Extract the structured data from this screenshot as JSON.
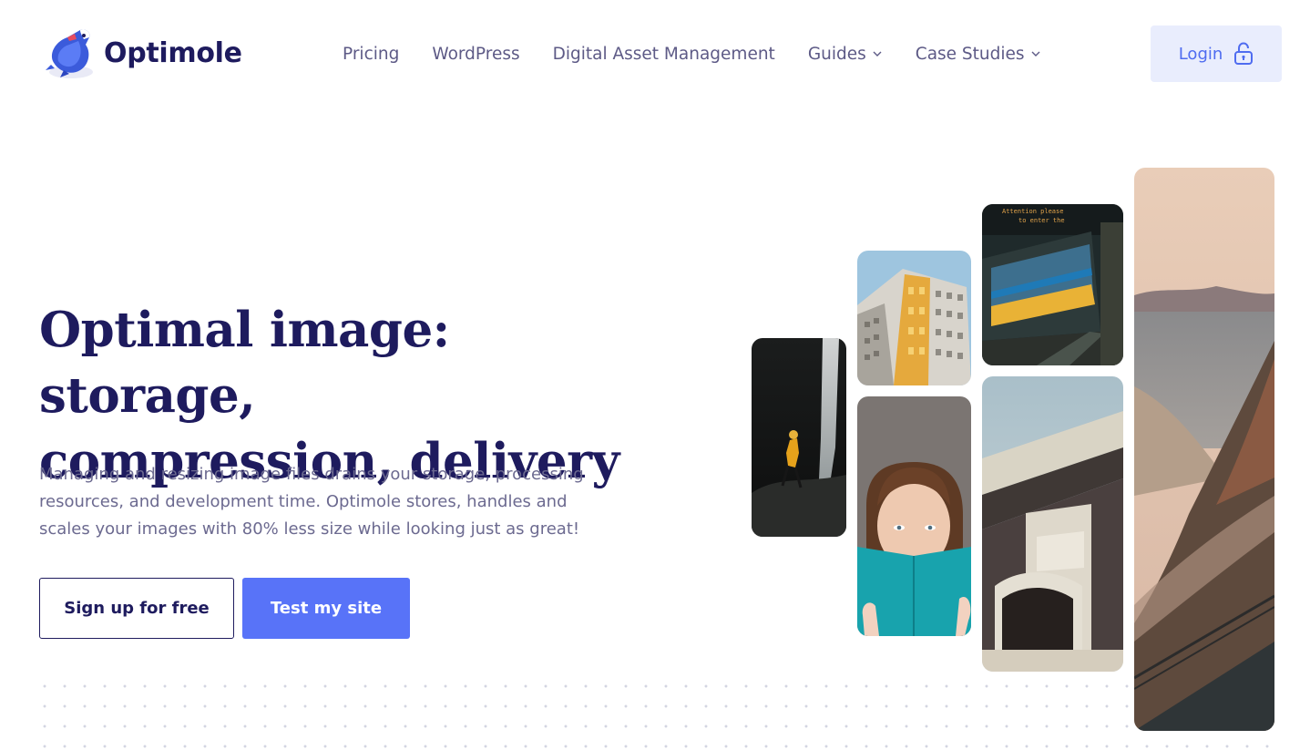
{
  "brand": {
    "name": "Optimole",
    "logo_icon": "optimole-mole-mascot-icon"
  },
  "nav": {
    "items": [
      {
        "label": "Pricing",
        "has_dropdown": false
      },
      {
        "label": "WordPress",
        "has_dropdown": false
      },
      {
        "label": "Digital Asset Management",
        "has_dropdown": false
      },
      {
        "label": "Guides",
        "has_dropdown": true
      },
      {
        "label": "Case Studies",
        "has_dropdown": true
      }
    ],
    "dropdown_icon": "chevron-down-icon"
  },
  "login": {
    "label": "Login",
    "icon": "unlock-icon"
  },
  "hero": {
    "title_line1": "Optimal image: storage,",
    "title_line2": "compression, delivery",
    "description": "Managing and resizing image files drains your storage, processing resources, and development time. Optimole stores, handles and scales your images with 80% less size while looking just as great!",
    "primary_cta": "Test my site",
    "secondary_cta": "Sign up for free"
  },
  "gallery": {
    "images": [
      {
        "name": "hiker-at-waterfall"
      },
      {
        "name": "building-facade"
      },
      {
        "name": "woman-reading-book"
      },
      {
        "name": "train-station"
      },
      {
        "name": "concrete-bridge"
      },
      {
        "name": "coastal-cliffs"
      }
    ]
  },
  "colors": {
    "brand_navy": "#1e1b5e",
    "accent_blue": "#5873f8",
    "login_bg": "#e9edfd",
    "nav_text": "#5d5a86",
    "body_text": "#6c6a90"
  }
}
